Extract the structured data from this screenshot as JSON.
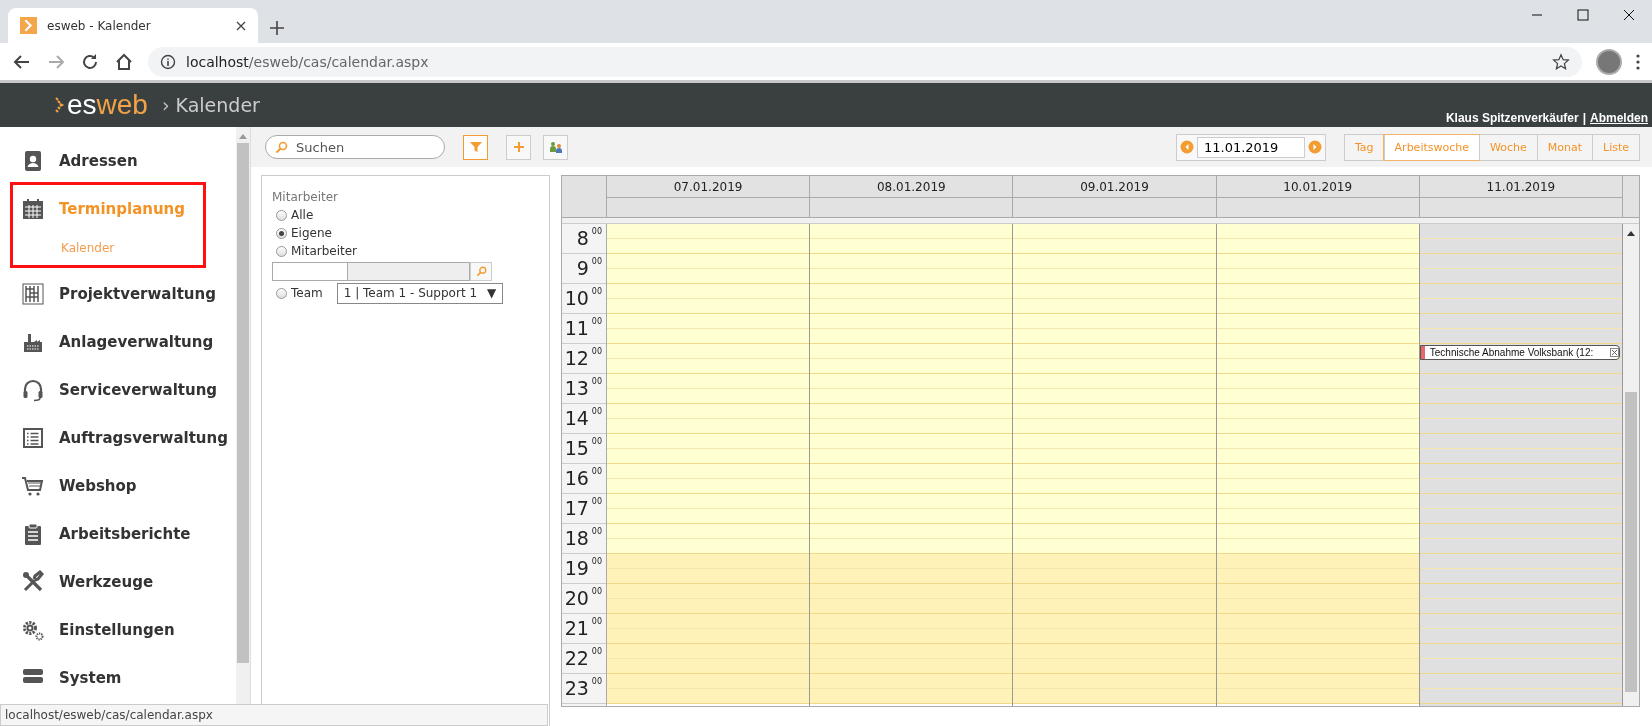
{
  "browser": {
    "tab_title": "esweb - Kalender",
    "url_host": "localhost",
    "url_path": "/esweb/cas/calendar.aspx"
  },
  "header": {
    "logo_first": "es",
    "logo_second": "web",
    "separator": "›",
    "page_title": "Kalender",
    "user": "Klaus Spitzenverkäufer",
    "divider": "|",
    "logout": "Abmelden"
  },
  "sidebar": {
    "items": [
      {
        "label": "Adressen",
        "selected": false
      },
      {
        "label": "Terminplanung",
        "selected": true,
        "highlighted": true,
        "children": [
          {
            "label": "Kalender"
          }
        ]
      },
      {
        "label": "Projektverwaltung",
        "selected": false
      },
      {
        "label": "Anlageverwaltung",
        "selected": false
      },
      {
        "label": "Serviceverwaltung",
        "selected": false
      },
      {
        "label": "Auftragsverwaltung",
        "selected": false
      },
      {
        "label": "Webshop",
        "selected": false
      },
      {
        "label": "Arbeitsberichte",
        "selected": false
      },
      {
        "label": "Werkzeuge",
        "selected": false
      },
      {
        "label": "Einstellungen",
        "selected": false
      },
      {
        "label": "System",
        "selected": false
      }
    ]
  },
  "toolbar": {
    "search": {
      "placeholder": "Suchen"
    },
    "filter_active": true,
    "date": "11.01.2019",
    "views": [
      {
        "label": "Tag",
        "selected": false
      },
      {
        "label": "Arbeitswoche",
        "selected": true
      },
      {
        "label": "Woche",
        "selected": false
      },
      {
        "label": "Monat",
        "selected": false
      },
      {
        "label": "Liste",
        "selected": false
      }
    ]
  },
  "filter": {
    "title": "Mitarbeiter",
    "options": [
      {
        "kind": "plain",
        "label": "Alle",
        "selected": false
      },
      {
        "kind": "plain",
        "label": "Eigene",
        "selected": true
      },
      {
        "kind": "lookup",
        "label": "Mitarbeiter",
        "selected": false
      },
      {
        "kind": "select",
        "label": "Team",
        "selected": false,
        "value": "1 | Team 1 - Support 1",
        "arrow": "▼"
      }
    ]
  },
  "calendar": {
    "days": [
      {
        "date": "07.01.2019",
        "selected": false
      },
      {
        "date": "08.01.2019",
        "selected": false
      },
      {
        "date": "09.01.2019",
        "selected": false
      },
      {
        "date": "10.01.2019",
        "selected": false
      },
      {
        "date": "11.01.2019",
        "selected": true
      }
    ],
    "hours": [
      {
        "hour": "8",
        "minutes": "00",
        "off_hours": false
      },
      {
        "hour": "9",
        "minutes": "00",
        "off_hours": false
      },
      {
        "hour": "10",
        "minutes": "00",
        "off_hours": false
      },
      {
        "hour": "11",
        "minutes": "00",
        "off_hours": false
      },
      {
        "hour": "12",
        "minutes": "00",
        "off_hours": false,
        "cells": [
          {},
          {},
          {},
          {},
          {
            "events": [
              {
                "title": "Technische Abnahme Volksbank (12:",
                "color": "#e8676b"
              }
            ]
          }
        ]
      },
      {
        "hour": "13",
        "minutes": "00",
        "off_hours": false
      },
      {
        "hour": "14",
        "minutes": "00",
        "off_hours": false
      },
      {
        "hour": "15",
        "minutes": "00",
        "off_hours": false
      },
      {
        "hour": "16",
        "minutes": "00",
        "off_hours": false
      },
      {
        "hour": "17",
        "minutes": "00",
        "off_hours": false
      },
      {
        "hour": "18",
        "minutes": "00",
        "off_hours": false
      },
      {
        "hour": "19",
        "minutes": "00",
        "off_hours": true
      },
      {
        "hour": "20",
        "minutes": "00",
        "off_hours": true
      },
      {
        "hour": "21",
        "minutes": "00",
        "off_hours": true
      },
      {
        "hour": "22",
        "minutes": "00",
        "off_hours": true
      },
      {
        "hour": "23",
        "minutes": "00",
        "off_hours": true
      }
    ]
  },
  "status_bar": {
    "url": "localhost/esweb/cas/calendar.aspx"
  }
}
